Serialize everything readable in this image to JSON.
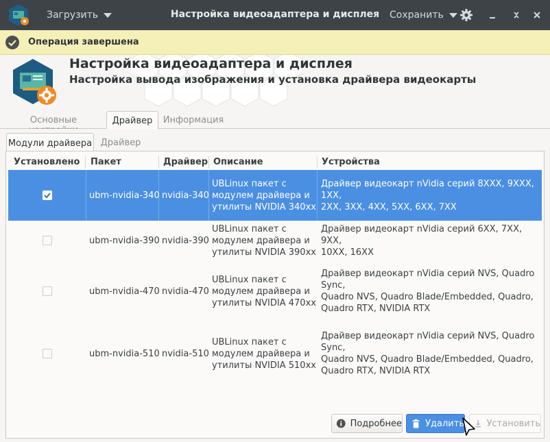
{
  "titlebar": {
    "load_label": "Загрузить",
    "title": "Настройка видеоадаптера и дисплея",
    "save_label": "Сохранить",
    "icons": [
      "app-icon",
      "chevron-down-icon",
      "gear-icon",
      "minimize-icon",
      "restore-icon",
      "close-icon"
    ]
  },
  "infobar": {
    "message": "Операция завершена",
    "icon": "check-circle-icon"
  },
  "header": {
    "title": "Настройка видеоадаптера и дисплея",
    "subtitle": "Настройка вывода изображения и установка драйвера видеокарты"
  },
  "main_tabs": [
    {
      "label": "Основные настройки",
      "active": false
    },
    {
      "label": "Драйвер",
      "active": true
    },
    {
      "label": "Информация",
      "active": false
    }
  ],
  "sub_tabs": [
    {
      "label": "Модули драйвера",
      "active": true
    },
    {
      "label": "Драйвер",
      "active": false
    }
  ],
  "table": {
    "columns": [
      "Установлено",
      "Пакет",
      "Драйвер",
      "Описание",
      "Устройства"
    ],
    "rows": [
      {
        "installed": true,
        "selected": true,
        "package": "ubm-nvidia-340",
        "driver": "nvidia-340",
        "description": [
          "UBLinux пакет с",
          "модулем драйвера и",
          "утилиты NVIDIA 340xx"
        ],
        "devices": [
          "Драйвер видеокарт nVidia серий 8XXX, 9XXX, 1XX,",
          "2XX, 3XX, 4XX, 5XX, 6XX, 7XX"
        ]
      },
      {
        "installed": false,
        "selected": false,
        "package": "ubm-nvidia-390",
        "driver": "nvidia-390",
        "description": [
          "UBLinux пакет с",
          "модулем драйвера и",
          "утилиты NVIDIA 390xx"
        ],
        "devices": [
          "Драйвер видеокарт nVidia серий 6XX, 7XX, 9XX,",
          "10XX, 16XX"
        ]
      },
      {
        "installed": false,
        "selected": false,
        "package": "ubm-nvidia-470",
        "driver": "nvidia-470",
        "description": [
          "UBLinux пакет с",
          "модулем драйвера и",
          "утилиты NVIDIA 470xx"
        ],
        "devices": [
          "Драйвер видеокарт nVidia серий NVS, Quadro Sync,",
          "Quadro NVS, Quadro Blade/Embedded, Quadro,",
          "Quadro RTX, NVIDIA RTX"
        ]
      },
      {
        "installed": false,
        "selected": false,
        "package": "ubm-nvidia-510",
        "driver": "nvidia-510",
        "description": [
          "UBLinux пакет с",
          "модулем драйвера и",
          "утилиты NVIDIA 510xx"
        ],
        "devices": [
          "Драйвер видеокарт nVidia серий NVS, Quadro Sync,",
          "Quadro NVS, Quadro Blade/Embedded, Quadro,",
          "Quadro RTX, NVIDIA RTX"
        ]
      }
    ]
  },
  "buttons": {
    "details": "Подробнее",
    "remove": "Удалить",
    "install": "Установить"
  },
  "colors": {
    "titlebar": "#3d4347",
    "infobar": "#f5efb8",
    "selection": "#4a8fe2",
    "window": "#f6f5f4"
  }
}
